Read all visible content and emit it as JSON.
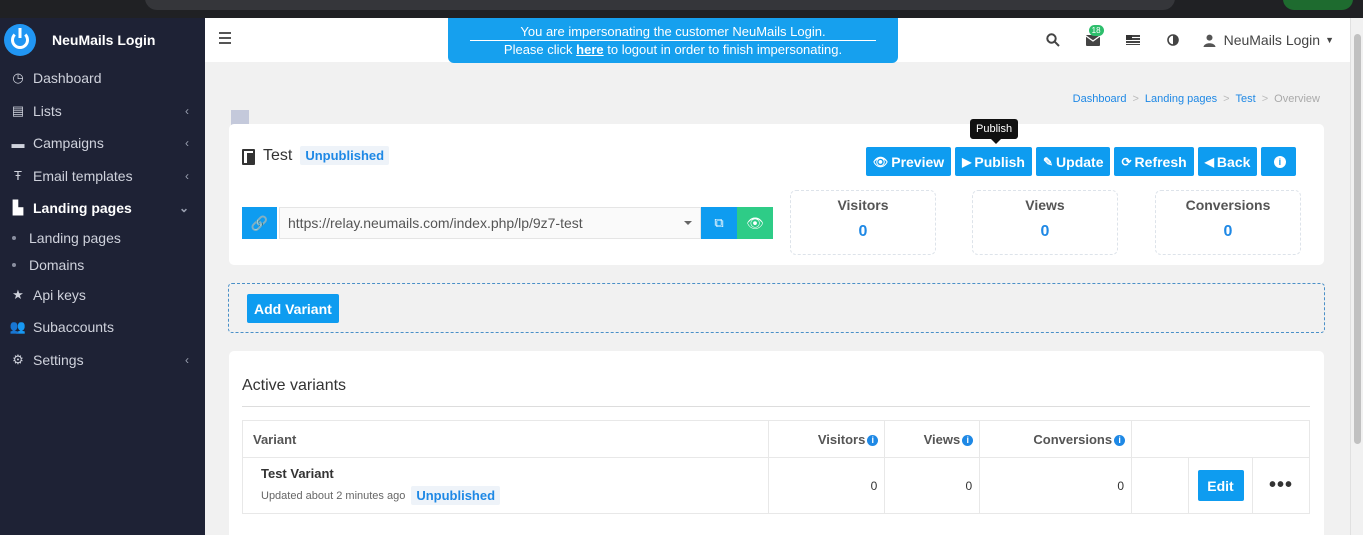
{
  "sidebar": {
    "brand": "NeuMails Login",
    "items": [
      {
        "label": "Dashboard",
        "icon": "dashboard-icon",
        "chevron": ""
      },
      {
        "label": "Lists",
        "icon": "list-icon",
        "chevron": "‹"
      },
      {
        "label": "Campaigns",
        "icon": "campaigns-icon",
        "chevron": "‹"
      },
      {
        "label": "Email templates",
        "icon": "text-icon",
        "chevron": "‹"
      },
      {
        "label": "Landing pages",
        "icon": "landing-pages-icon",
        "chevron": "⌄"
      }
    ],
    "subitems": [
      "Landing pages",
      "Domains"
    ],
    "items2": [
      {
        "label": "Api keys",
        "icon": "star-icon",
        "chevron": ""
      },
      {
        "label": "Subaccounts",
        "icon": "users-icon",
        "chevron": ""
      },
      {
        "label": "Settings",
        "icon": "gear-icon",
        "chevron": "‹"
      }
    ]
  },
  "header": {
    "notice_line1": "You are impersonating the customer NeuMails Login.",
    "notice_pre": "Please click ",
    "notice_link": "here",
    "notice_post": " to logout in order to finish impersonating.",
    "mail_badge": "18",
    "user_name": "NeuMails Login"
  },
  "breadcrumb": {
    "items": [
      "Dashboard",
      "Landing pages",
      "Test"
    ],
    "current": "Overview",
    "separator": ">"
  },
  "page": {
    "title": "Test",
    "status": "Unpublished",
    "tooltip": "Publish",
    "buttons": {
      "preview": "Preview",
      "publish": "Publish",
      "update": "Update",
      "refresh": "Refresh",
      "back": "Back"
    },
    "url": "https://relay.neumails.com/index.php/lp/9z7-test",
    "stats": [
      {
        "label": "Visitors",
        "value": "0"
      },
      {
        "label": "Views",
        "value": "0"
      },
      {
        "label": "Conversions",
        "value": "0"
      }
    ]
  },
  "add_variant_label": "Add Variant",
  "variants": {
    "heading": "Active variants",
    "columns": {
      "variant": "Variant",
      "visitors": "Visitors",
      "views": "Views",
      "conversions": "Conversions"
    },
    "rows": [
      {
        "name": "Test Variant",
        "updated": "Updated about 2 minutes ago",
        "status": "Unpublished",
        "visitors": "0",
        "views": "0",
        "conversions": "0",
        "edit": "Edit"
      }
    ]
  },
  "colors": {
    "primary": "#0e9cf0",
    "success": "#2ecc87",
    "sidebar": "#1e2235",
    "link": "#1e88e5"
  }
}
